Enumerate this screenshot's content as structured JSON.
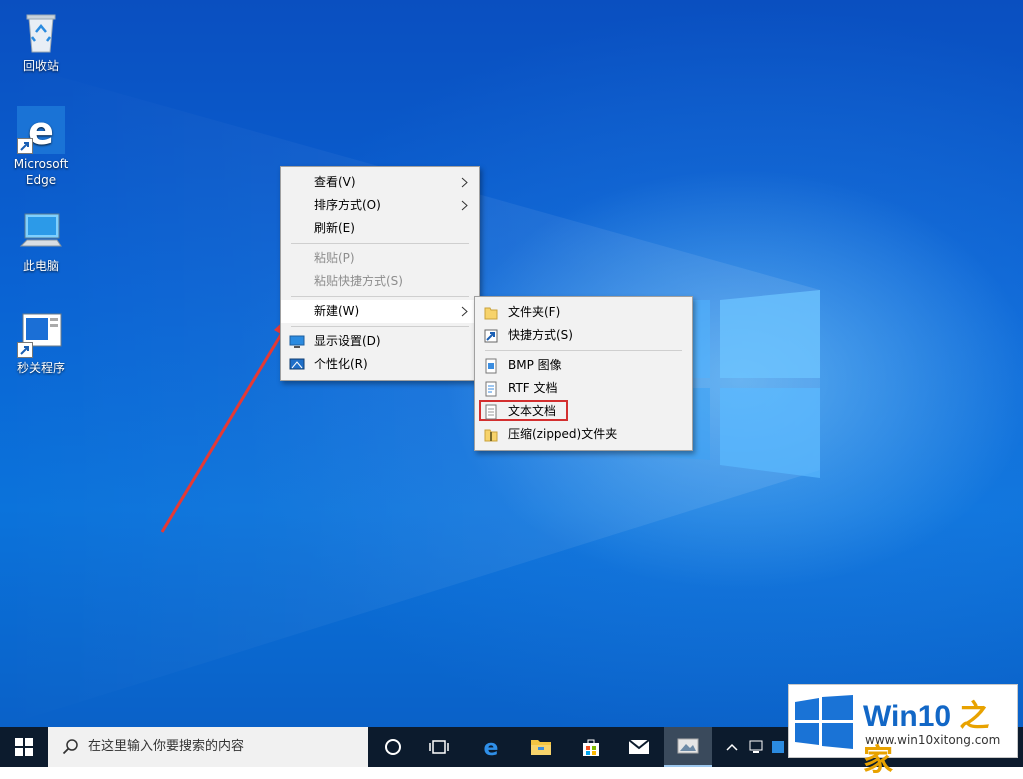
{
  "desktop_icons": [
    {
      "label": "回收站",
      "icon": "recycle-bin-icon"
    },
    {
      "label": "Microsoft Edge",
      "icon": "edge-icon"
    },
    {
      "label": "此电脑",
      "icon": "computer-icon"
    },
    {
      "label": "秒关程序",
      "icon": "program-icon"
    }
  ],
  "context_menu": {
    "items": [
      {
        "label": "查看(V)",
        "submenu": true
      },
      {
        "label": "排序方式(O)",
        "submenu": true
      },
      {
        "label": "刷新(E)"
      },
      {
        "label": "粘贴(P)",
        "disabled": true
      },
      {
        "label": "粘贴快捷方式(S)",
        "disabled": true
      },
      {
        "label": "新建(W)",
        "submenu": true,
        "highlighted": true
      },
      {
        "label": "显示设置(D)",
        "icon": "display-settings-icon"
      },
      {
        "label": "个性化(R)",
        "icon": "personalize-icon"
      }
    ]
  },
  "new_submenu": {
    "items": [
      {
        "label": "文件夹(F)",
        "icon": "folder-icon"
      },
      {
        "label": "快捷方式(S)",
        "icon": "shortcut-icon"
      },
      {
        "label": "BMP 图像",
        "icon": "bmp-image-icon"
      },
      {
        "label": "RTF 文档",
        "icon": "rtf-document-icon"
      },
      {
        "label": "文本文档",
        "icon": "text-document-icon",
        "highlighted_box": true
      },
      {
        "label": "压缩(zipped)文件夹",
        "icon": "zip-folder-icon"
      }
    ]
  },
  "taskbar": {
    "search_placeholder": "在这里输入你要搜索的内容",
    "buttons": [
      "start-icon",
      "cortana-icon",
      "task-view-icon",
      "edge-icon",
      "file-explorer-icon",
      "store-icon",
      "mail-icon",
      "photos-icon"
    ],
    "tray": [
      "chevron-up-icon",
      "network-icon",
      "tray-app-icon"
    ]
  },
  "watermark": {
    "brand_prefix": "Win10 ",
    "brand_suffix": "之家",
    "url": "www.win10xitong.com"
  },
  "colors": {
    "accent": "#0078d7",
    "highlight_box": "#d32f2f",
    "arrow": "#e53935",
    "taskbar": "#0c1b2d"
  }
}
